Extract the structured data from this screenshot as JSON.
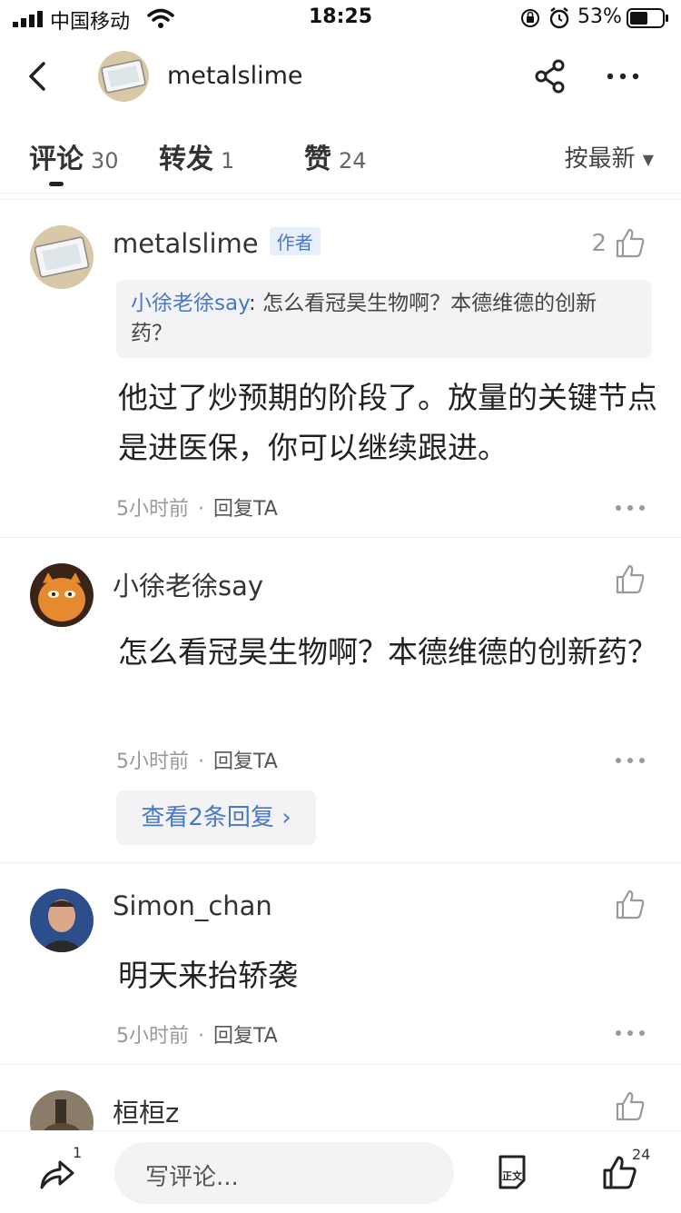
{
  "status_bar": {
    "carrier": "中国移动",
    "time": "18:25",
    "battery": "53%"
  },
  "header": {
    "username": "metalslime",
    "icons": [
      "back-icon",
      "share-icon",
      "more-icon"
    ]
  },
  "tabs": [
    {
      "label": "评论",
      "count": "30"
    },
    {
      "label": "转发",
      "count": "1"
    },
    {
      "label": "赞",
      "count": "24"
    }
  ],
  "sort_label": "按最新",
  "comments": [
    {
      "user": "metalslime",
      "badge": "作者",
      "likes": "2",
      "quote_user": "小徐老徐say",
      "quote_text": ": 怎么看冠昊生物啊？本德维德的创新药？",
      "body": "他过了炒预期的阶段了。放量的关键节点是进医保，你可以继续跟进。",
      "time": "5小时前",
      "reply": "回复TA"
    },
    {
      "user": "小徐老徐say",
      "body": "怎么看冠昊生物啊？本德维德的创新药？",
      "time": "5小时前",
      "reply": "回复TA",
      "view_replies": "查看2条回复"
    },
    {
      "user": "Simon_chan",
      "body": "明天来抬轿袭",
      "time": "5小时前",
      "reply": "回复TA"
    },
    {
      "user": "桓桓z"
    }
  ],
  "bottom_bar": {
    "share_count": "1",
    "input_placeholder": "写评论...",
    "like_count": "24"
  },
  "colors": {
    "accent_blue": "#4a78c8",
    "text_primary": "#222222",
    "text_secondary": "#999999"
  }
}
